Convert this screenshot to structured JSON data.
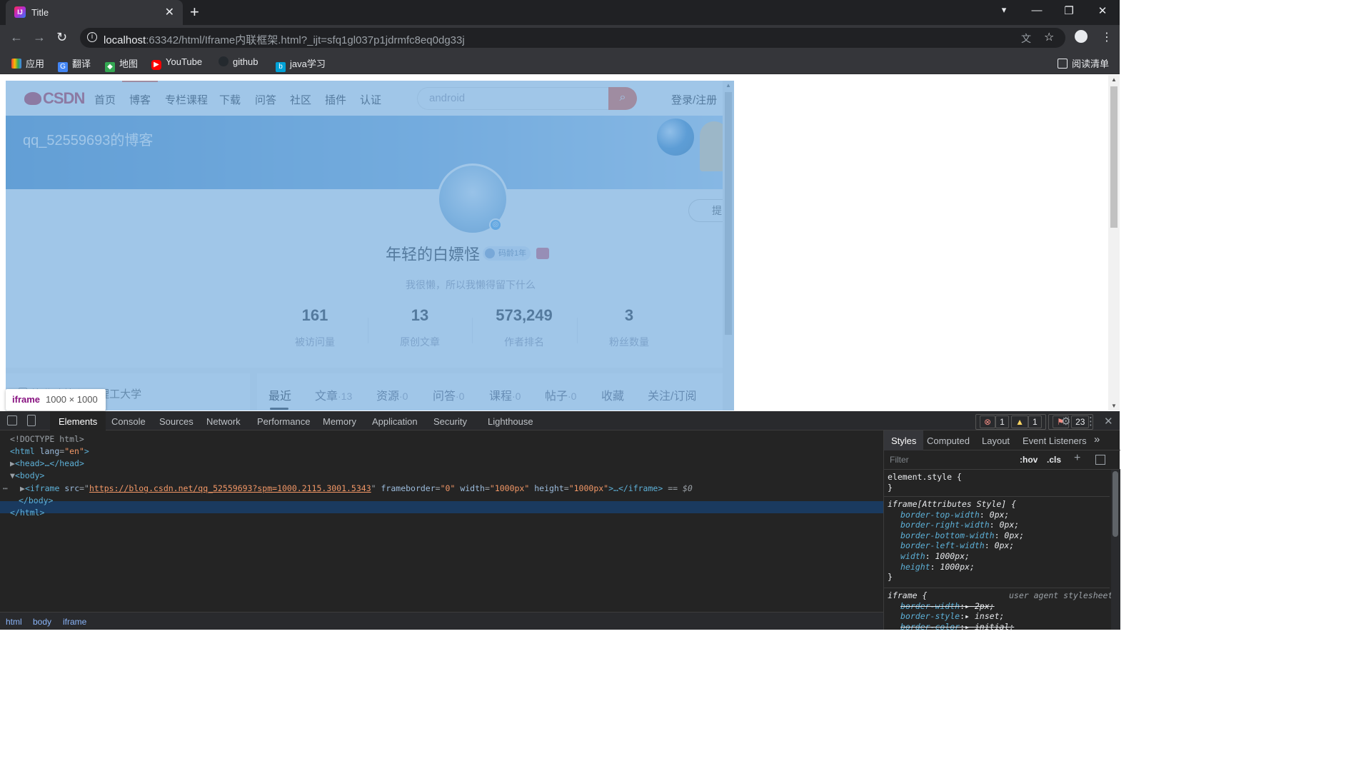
{
  "browser": {
    "tab_title": "Title",
    "url_host": "localhost",
    "url_rest": ":63342/html/Iframe内联框架.html?_ijt=sfq1gl037p1jdrmfc8eq0dg33j",
    "bookmarks": [
      "应用",
      "翻译",
      "地图",
      "YouTube",
      "github",
      "java学习"
    ],
    "reading_list": "阅读清单"
  },
  "csdn": {
    "logo": "CSDN",
    "nav": [
      "首页",
      "博客",
      "专栏课程",
      "下载",
      "问答",
      "社区",
      "插件",
      "认证"
    ],
    "search_placeholder": "android",
    "login": "登录/注册",
    "blog_title": "qq_52559693的博客",
    "follow_label": "提",
    "user_name": "年轻的白嫖怪",
    "code_age": "码龄1年",
    "motto": "我很懒，所以我懒得留下什么",
    "stats": [
      {
        "value": "161",
        "label": "被访问量"
      },
      {
        "value": "13",
        "label": "原创文章"
      },
      {
        "value": "573,249",
        "label": "作者排名"
      },
      {
        "value": "3",
        "label": "粉丝数量"
      }
    ],
    "left_card_text": "毕业院校  江西理工大学",
    "blog_tabs": [
      {
        "label": "最近",
        "count": ""
      },
      {
        "label": "文章",
        "count": "·13"
      },
      {
        "label": "资源",
        "count": "·0"
      },
      {
        "label": "问答",
        "count": "·0"
      },
      {
        "label": "课程",
        "count": "·0"
      },
      {
        "label": "帖子",
        "count": "·0"
      },
      {
        "label": "收藏",
        "count": ""
      },
      {
        "label": "关注/订阅",
        "count": ""
      }
    ]
  },
  "tooltip": {
    "tag": "iframe",
    "dims": "1000 × 1000"
  },
  "devtools": {
    "tabs": [
      "Elements",
      "Console",
      "Sources",
      "Network",
      "Performance",
      "Memory",
      "Application",
      "Security",
      "Lighthouse"
    ],
    "errors": "1",
    "warnings": "1",
    "issues": "23",
    "dom": {
      "doctype": "<!DOCTYPE html>",
      "html_open_tag": "<html",
      "html_attr": "lang",
      "html_attr_val": "\"en\"",
      "head": "<head>…</head>",
      "body_open": "<body>",
      "iframe_tag": "<iframe",
      "iframe_src_attr": "src",
      "iframe_src_val": "https://blog.csdn.net/qq_52559693?spm=1000.2115.3001.5343",
      "frameborder_attr": "frameborder",
      "frameborder_val": "\"0\"",
      "width_attr": "width",
      "width_val": "\"1000px\"",
      "height_attr": "height",
      "height_val": "\"1000px\"",
      "iframe_close": ">…</iframe>",
      "selected_marker": "== $0",
      "body_close": "</body>",
      "html_close": "</html>"
    },
    "breadcrumbs": [
      "html",
      "body",
      "iframe"
    ],
    "style_tabs": [
      "Styles",
      "Computed",
      "Layout",
      "Event Listeners"
    ],
    "filter_placeholder": "Filter",
    "hov": ":hov",
    ".cls": ".cls",
    "rules": {
      "element_style": "element.style {",
      "attr_style_selector": "iframe[Attributes Style] {",
      "attr_props": [
        {
          "prop": "border-top-width",
          "val": "0px;"
        },
        {
          "prop": "border-right-width",
          "val": "0px;"
        },
        {
          "prop": "border-bottom-width",
          "val": "0px;"
        },
        {
          "prop": "border-left-width",
          "val": "0px;"
        },
        {
          "prop": "width",
          "val": "1000px;"
        },
        {
          "prop": "height",
          "val": "1000px;"
        }
      ],
      "ua_selector": "iframe {",
      "ua_source": "user agent stylesheet",
      "ua_props": [
        {
          "prop": "border-width",
          "val": "2px;"
        },
        {
          "prop": "border-style",
          "val": "inset;"
        },
        {
          "prop": "border-color",
          "val": "initial;"
        }
      ],
      "close_brace": "}"
    }
  }
}
